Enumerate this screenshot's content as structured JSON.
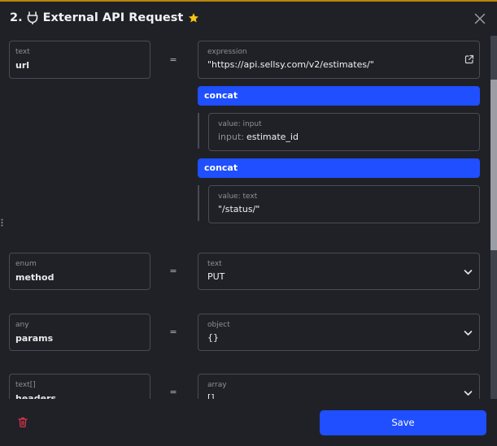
{
  "header": {
    "step_number": "2.",
    "title": "External API Request",
    "icon": "plug-icon",
    "favorite_icon": "star-icon",
    "close_icon": "close-icon",
    "accent_color": "#b8860b",
    "star_color": "#f5c518"
  },
  "rows": {
    "url": {
      "type": "text",
      "name": "url",
      "equals": "=",
      "value_type": "expression",
      "value": "\"https://api.sellsy.com/v2/estimates/\"",
      "concat_1": "concat",
      "input_value_type": "value: input",
      "input_prefix": "input:",
      "input_value": "estimate_id",
      "concat_2": "concat",
      "text_value_type": "value: text",
      "text_value": "\"/status/\""
    },
    "method": {
      "type": "enum",
      "name": "method",
      "equals": "=",
      "value_type": "text",
      "value": "PUT"
    },
    "params": {
      "type": "any",
      "name": "params",
      "equals": "=",
      "value_type": "object",
      "value": "{}"
    },
    "headers": {
      "type": "text[]",
      "name": "headers",
      "equals": "=",
      "value_type": "array",
      "value": "[]"
    }
  },
  "footer": {
    "save_label": "Save",
    "delete_icon": "trash-icon",
    "primary_color": "#1f4fff",
    "danger_color": "#e0344b"
  }
}
